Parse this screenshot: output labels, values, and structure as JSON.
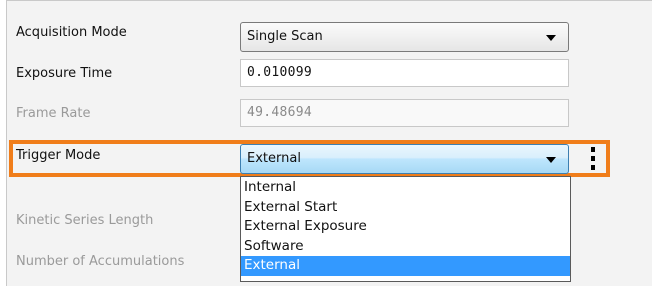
{
  "rows": {
    "acquisition_mode": {
      "label": "Acquisition Mode",
      "value": "Single Scan"
    },
    "exposure_time": {
      "label": "Exposure Time",
      "value": "0.010099"
    },
    "frame_rate": {
      "label": "Frame Rate",
      "value": "49.48694"
    },
    "trigger_mode": {
      "label": "Trigger Mode",
      "value": "External"
    },
    "kinetic_series_length": {
      "label": "Kinetic Series Length"
    },
    "number_of_accumulations": {
      "label": "Number of Accumulations"
    }
  },
  "trigger_dropdown": {
    "options": [
      "Internal",
      "External Start",
      "External Exposure",
      "Software",
      "External"
    ],
    "selected": "External"
  },
  "colors": {
    "highlight_border": "#f07d1a",
    "selected_option": "#3399ff",
    "active_combo": "#bee6fd"
  },
  "icons": {
    "combo_arrow": "triangle-down",
    "more_options": "vertical-ellipsis"
  }
}
